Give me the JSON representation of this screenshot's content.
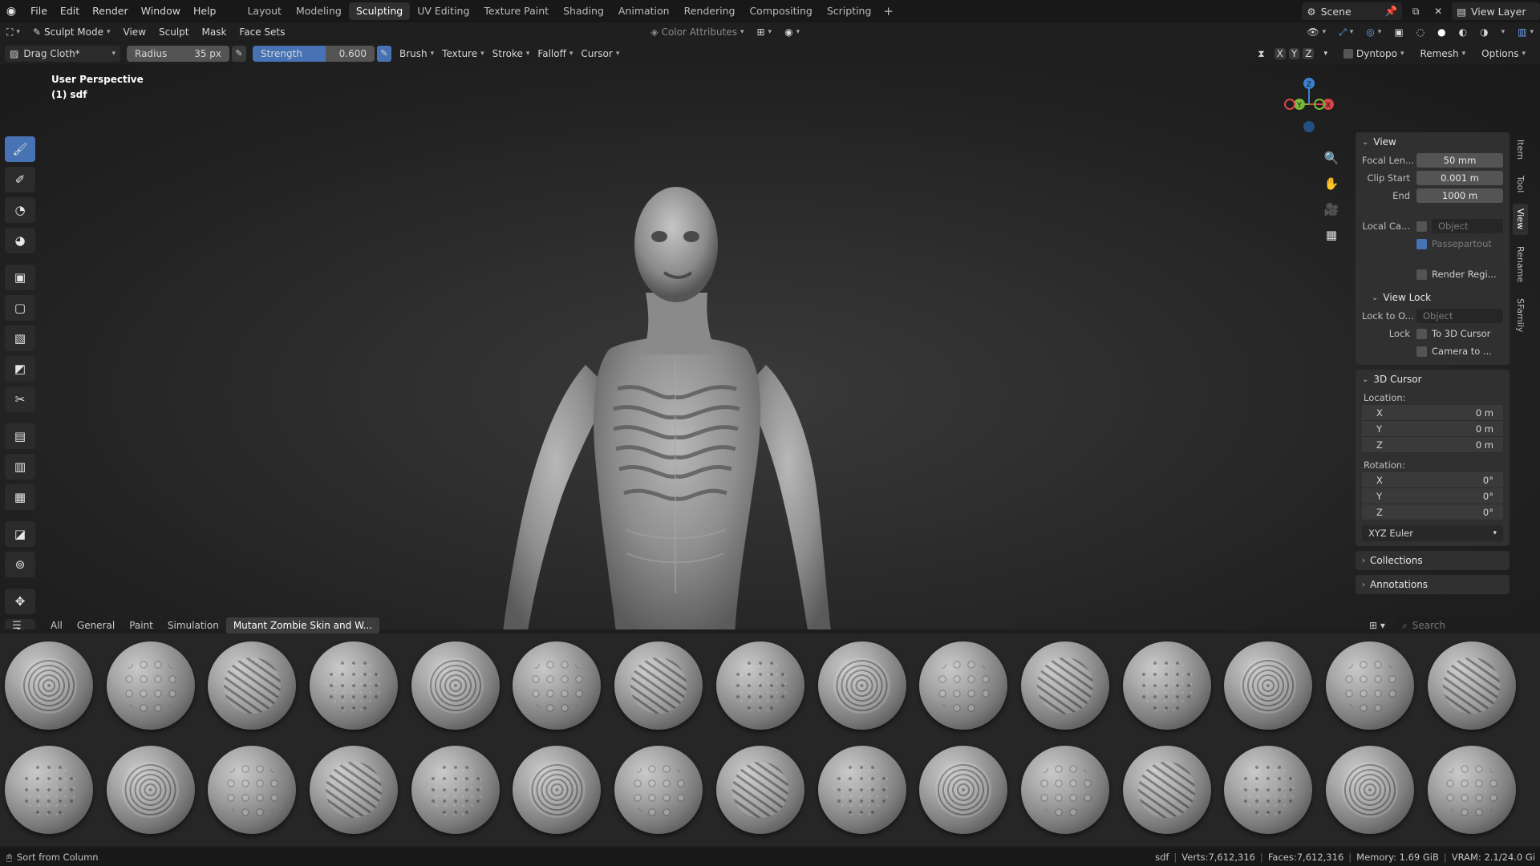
{
  "menu": [
    "File",
    "Edit",
    "Render",
    "Window",
    "Help"
  ],
  "workspaces": [
    "Layout",
    "Modeling",
    "Sculpting",
    "UV Editing",
    "Texture Paint",
    "Shading",
    "Animation",
    "Rendering",
    "Compositing",
    "Scripting"
  ],
  "active_workspace": "Sculpting",
  "scene": "Scene",
  "view_layer": "View Layer",
  "header": {
    "mode": "Sculpt Mode",
    "menus": [
      "View",
      "Sculpt",
      "Mask",
      "Face Sets"
    ],
    "color_attributes": "Color Attributes",
    "axes": [
      "X",
      "Y",
      "Z"
    ],
    "dyntopo": "Dyntopo",
    "remesh": "Remesh",
    "options": "Options"
  },
  "tool_settings": {
    "brush": "Drag Cloth*",
    "radius_label": "Radius",
    "radius_value": "35 px",
    "strength_label": "Strength",
    "strength_value": "0.600",
    "strength_fraction": 0.6,
    "menus": [
      "Brush",
      "Texture",
      "Stroke",
      "Falloff",
      "Cursor"
    ]
  },
  "viewport": {
    "perspective": "User Perspective",
    "object": "(1) sdf"
  },
  "gizmo": {
    "z": "Z",
    "y": "Y",
    "x": "X"
  },
  "npanel": {
    "tabs": [
      "Item",
      "Tool",
      "View",
      "Rename",
      "SFamily"
    ],
    "active_tab": "View",
    "view": {
      "title": "View",
      "focal_length_label": "Focal Len...",
      "focal_length": "50 mm",
      "clip_start_label": "Clip Start",
      "clip_start": "0.001 m",
      "clip_end_label": "End",
      "clip_end": "1000 m",
      "local_camera_label": "Local Ca...",
      "local_camera_placeholder": "Object",
      "passepartout": "Passepartout",
      "render_region": "Render Regi..."
    },
    "view_lock": {
      "title": "View Lock",
      "lock_to_object_label": "Lock to O...",
      "lock_to_object_placeholder": "Object",
      "lock_label": "Lock",
      "to_3d_cursor": "To 3D Cursor",
      "camera_to_view": "Camera to ..."
    },
    "cursor": {
      "title": "3D Cursor",
      "location_label": "Location:",
      "location": [
        {
          "axis": "X",
          "value": "0 m"
        },
        {
          "axis": "Y",
          "value": "0 m"
        },
        {
          "axis": "Z",
          "value": "0 m"
        }
      ],
      "rotation_label": "Rotation:",
      "rotation": [
        {
          "axis": "X",
          "value": "0°"
        },
        {
          "axis": "Y",
          "value": "0°"
        },
        {
          "axis": "Z",
          "value": "0°"
        }
      ],
      "rotation_mode": "XYZ Euler"
    },
    "collections": "Collections",
    "annotations": "Annotations"
  },
  "shelf": {
    "tabs": [
      "All",
      "General",
      "Paint",
      "Simulation",
      "Mutant Zombie Skin and W..."
    ],
    "active_tab": "Mutant Zombie Skin and W...",
    "search_placeholder": "Search",
    "brush_count": 30
  },
  "status": {
    "left": "Sort from Column",
    "object": "sdf",
    "verts": "Verts:7,612,316",
    "faces": "Faces:7,612,316",
    "memory": "Memory: 1.69 GiB",
    "vram": "VRAM: 2.1/24.0 Gi"
  },
  "colors": {
    "accent": "#4772b3",
    "x_axis": "#d9454a",
    "y_axis": "#78b83b",
    "z_axis": "#3a82cf"
  }
}
